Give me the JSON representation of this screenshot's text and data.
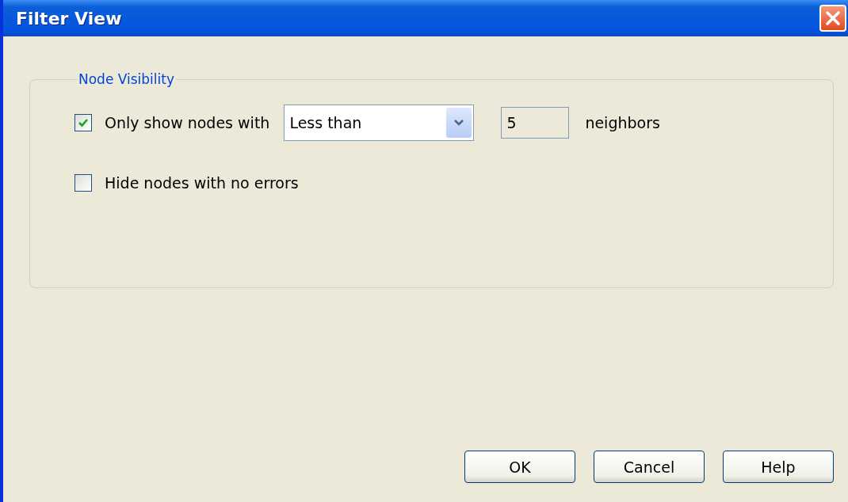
{
  "window": {
    "title": "Filter View"
  },
  "group": {
    "legend": "Node Visibility",
    "rows": [
      {
        "kind": "filter",
        "label": "Only show nodes with",
        "checked": true,
        "dropdown": {
          "value": "Less than"
        },
        "field": {
          "value": "5"
        },
        "suffix": "neighbors"
      },
      {
        "kind": "plain",
        "label": "Hide nodes with no errors",
        "checked": false
      }
    ]
  },
  "buttons": [
    "OK",
    "Cancel",
    "Help"
  ]
}
